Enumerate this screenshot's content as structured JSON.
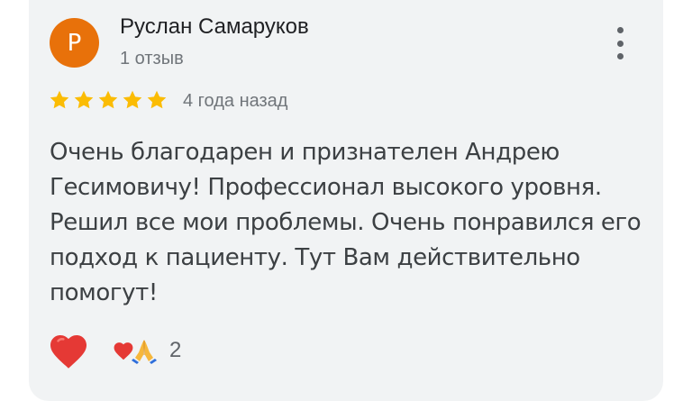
{
  "review": {
    "author": {
      "name": "Руслан Самаруков",
      "initial": "Р",
      "avatar_color": "#e8710a",
      "review_count": "1 отзыв"
    },
    "rating": 5,
    "max_rating": 5,
    "star_color": "#fbbc04",
    "date": "4 года назад",
    "text": "Очень благодарен и признателен Андрею Гесимовичу! Профессионал высокого уровня. Решил все мои проблемы. Очень понравился его подход к пациенту. Тут Вам действительно помогут!",
    "reactions": {
      "like_icon": "heart-icon",
      "emoji": [
        "red-heart",
        "folded-hands"
      ],
      "count": "2"
    }
  },
  "icons": {
    "menu": "more-vert-icon"
  }
}
